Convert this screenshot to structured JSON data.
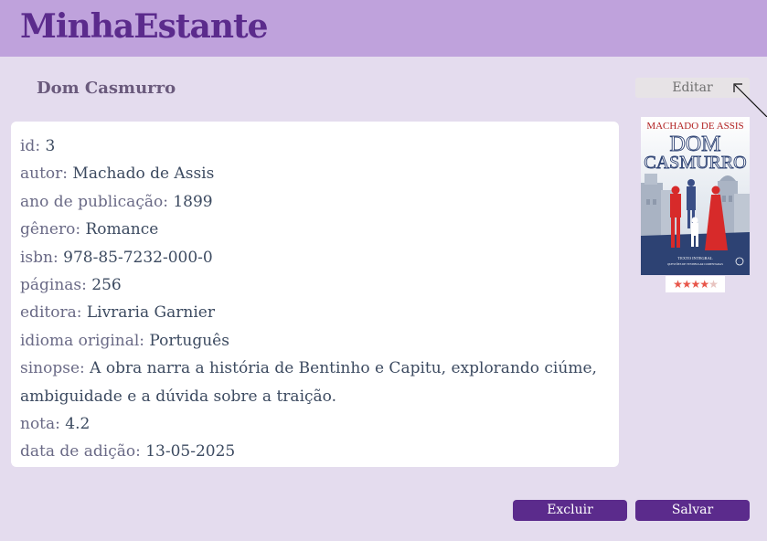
{
  "app": {
    "title": "MinhaEstante"
  },
  "book": {
    "title": "Dom Casmurro",
    "edit_label": "Editar",
    "details": [
      {
        "key": "id: ",
        "value": "3"
      },
      {
        "key": "autor: ",
        "value": "Machado de Assis"
      },
      {
        "key": "ano de publicação: ",
        "value": "1899"
      },
      {
        "key": "gênero: ",
        "value": "Romance"
      },
      {
        "key": "isbn: ",
        "value": "978-85-7232-000-0"
      },
      {
        "key": "páginas: ",
        "value": "256"
      },
      {
        "key": "editora: ",
        "value": "Livraria Garnier"
      },
      {
        "key": "idioma original: ",
        "value": "Português"
      },
      {
        "key": "sinopse: ",
        "value": "A obra narra a história de Bentinho e Capitu, explorando ciúme,"
      },
      {
        "key": "",
        "value": "ambiguidade e a dúvida sobre a traição."
      },
      {
        "key": "nota: ",
        "value": "4.2"
      },
      {
        "key": "data de adição: ",
        "value": "13-05-2025"
      }
    ],
    "cover": {
      "author": "MACHADO DE ASSIS",
      "title_line1": "DOM",
      "title_line2": "CASMURRO",
      "subtitle": "TEXTO INTEGRAL",
      "subtitle2": "QUESTÕES DE VESTIBULAR COMENTADAS"
    },
    "rating": {
      "value": 4.2,
      "max": 5,
      "stars": "★★★★★"
    }
  },
  "actions": {
    "delete_label": "Excluir",
    "save_label": "Salvar"
  },
  "colors": {
    "accent": "#5b2b8c",
    "header": "#bfa2dc",
    "background": "#e4dcee",
    "star": "#e8564a"
  }
}
